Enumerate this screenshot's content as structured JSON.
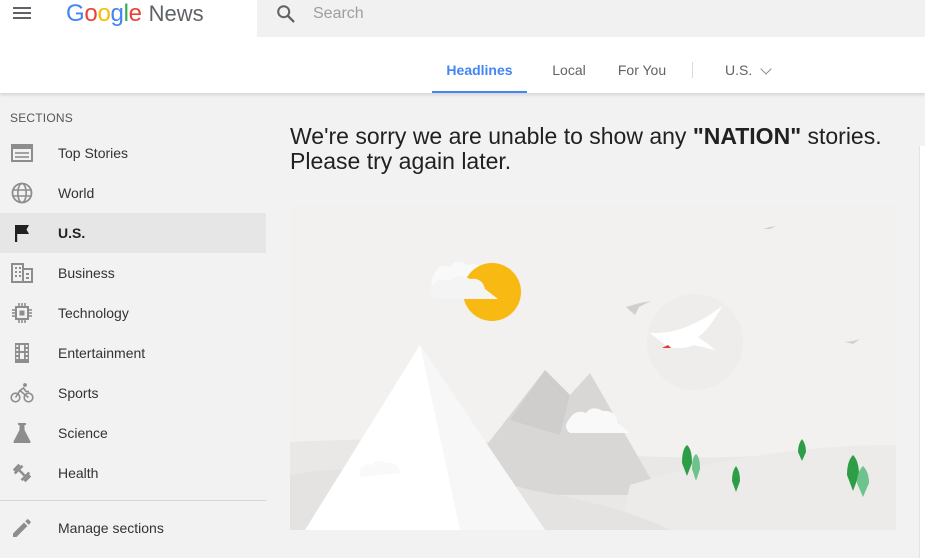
{
  "header": {
    "logo_google": "Google",
    "logo_news": "News",
    "search": {
      "placeholder": "Search",
      "value": ""
    },
    "tabs": [
      {
        "label": "Headlines",
        "active": true
      },
      {
        "label": "Local",
        "active": false
      },
      {
        "label": "For You",
        "active": false
      }
    ],
    "edition": "U.S."
  },
  "sidebar": {
    "heading": "SECTIONS",
    "items": [
      {
        "label": "Top Stories",
        "icon": "top-stories-icon",
        "active": false
      },
      {
        "label": "World",
        "icon": "globe-icon",
        "active": false
      },
      {
        "label": "U.S.",
        "icon": "flag-icon",
        "active": true
      },
      {
        "label": "Business",
        "icon": "business-icon",
        "active": false
      },
      {
        "label": "Technology",
        "icon": "chip-icon",
        "active": false
      },
      {
        "label": "Entertainment",
        "icon": "film-icon",
        "active": false
      },
      {
        "label": "Sports",
        "icon": "bike-icon",
        "active": false
      },
      {
        "label": "Science",
        "icon": "flask-icon",
        "active": false
      },
      {
        "label": "Health",
        "icon": "dumbbell-icon",
        "active": false
      }
    ],
    "manage": {
      "label": "Manage sections",
      "icon": "pencil-icon"
    }
  },
  "main": {
    "message": {
      "before": "We're sorry we are unable to show any ",
      "quote_open": "\"",
      "keyword": "NATION",
      "quote_close": "\"",
      "after": " stories. Please try again later."
    }
  },
  "colors": {
    "accent": "#4285f4",
    "sun": "#f9b913",
    "tree_dark": "#2e9d47",
    "tree_light": "#6cc38b",
    "background": "#f2f2f2"
  }
}
